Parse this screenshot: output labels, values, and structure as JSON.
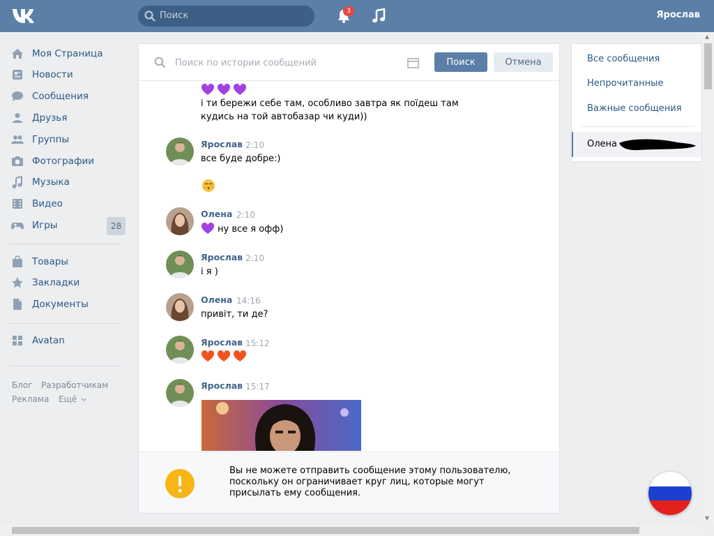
{
  "header": {
    "search_placeholder": "Поиск",
    "notifications_count": "3",
    "user_name": "Ярослав"
  },
  "sidebar": {
    "items": [
      {
        "label": "Моя Страница",
        "icon": "home-icon"
      },
      {
        "label": "Новости",
        "icon": "news-icon"
      },
      {
        "label": "Сообщения",
        "icon": "messages-icon"
      },
      {
        "label": "Друзья",
        "icon": "friends-icon"
      },
      {
        "label": "Группы",
        "icon": "groups-icon"
      },
      {
        "label": "Фотографии",
        "icon": "camera-icon"
      },
      {
        "label": "Музыка",
        "icon": "music-icon"
      },
      {
        "label": "Видео",
        "icon": "video-icon"
      },
      {
        "label": "Игры",
        "icon": "gamepad-icon",
        "count": "28"
      },
      {
        "label": "Товары",
        "icon": "bag-icon"
      },
      {
        "label": "Закладки",
        "icon": "star-icon"
      },
      {
        "label": "Документы",
        "icon": "document-icon"
      },
      {
        "label": "Avatan",
        "icon": "apps-icon"
      }
    ],
    "footer": [
      "Блог",
      "Разработчикам",
      "Реклама",
      "Ещё"
    ]
  },
  "search_bar": {
    "placeholder": "Поиск по истории сообщений",
    "search_label": "Поиск",
    "cancel_label": "Отмена"
  },
  "messages": [
    {
      "text": "і ти бережи себе там, особливо завтра як поїдеш там кудись на той автобазар чи куди))"
    },
    {
      "author": "Ярослав",
      "time": "2:10",
      "text": "все буде добре:)"
    },
    {
      "author": "Олена",
      "time": "2:10",
      "text": "ну все я офф)"
    },
    {
      "author": "Ярослав",
      "time": "2:10",
      "text": "і я )"
    },
    {
      "author": "Олена",
      "time": "14:16",
      "text": "привіт, ти де?"
    },
    {
      "author": "Ярослав",
      "time": "15:12",
      "text": ""
    },
    {
      "author": "Ярослав",
      "time": "15:17",
      "text": ""
    }
  ],
  "notice": {
    "text": "Вы не можете отправить сообщение этому пользователю, поскольку он ограничивает круг лиц, которые могут присылать ему сообщения."
  },
  "right_panel": {
    "items": [
      "Все сообщения",
      "Непрочитанные",
      "Важные сообщения"
    ],
    "active": "Олена"
  },
  "colors": {
    "header": "#5b7fa6",
    "link": "#2a5885",
    "author": "#42648b",
    "warning": "#f7b516",
    "heart_purple": "#a142e0",
    "heart_orange": "#f0541e"
  }
}
